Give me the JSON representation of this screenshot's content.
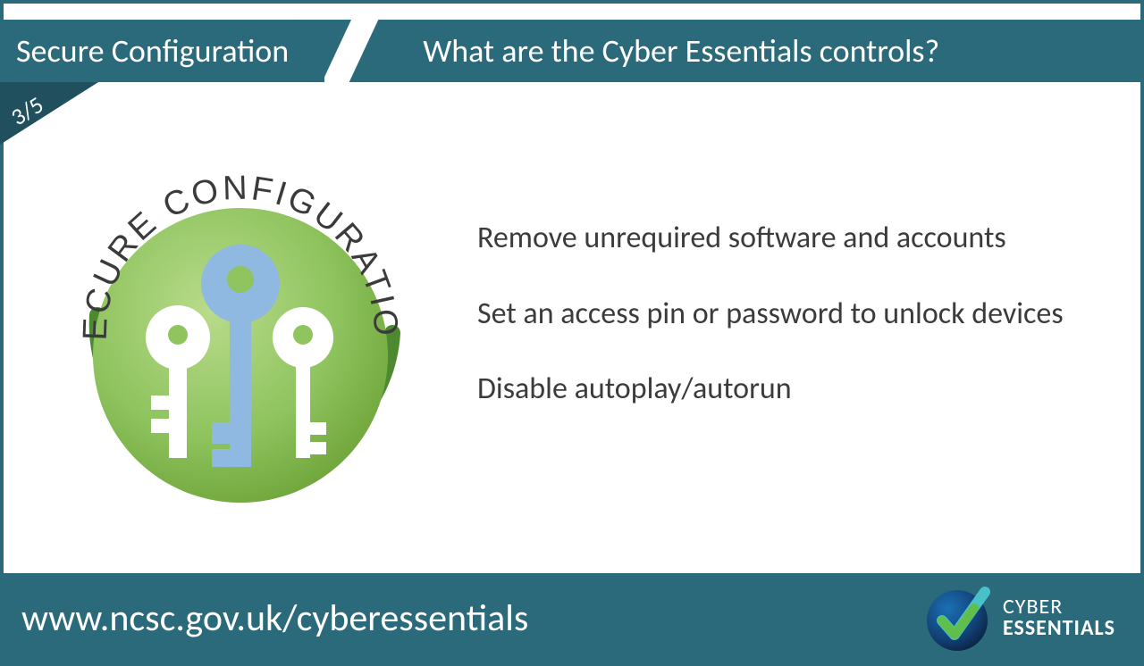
{
  "header": {
    "left": "Secure Configuration",
    "right": "What are the Cyber Essentials controls?"
  },
  "page_indicator": "3/5",
  "badge": {
    "curved_text": "SECURE CONFIGURATION"
  },
  "bullets": [
    "Remove unrequired software and accounts",
    "Set an access pin or password to unlock devices",
    "Disable autoplay/autorun"
  ],
  "footer": {
    "url": "www.ncsc.gov.uk/cyberessentials",
    "logo_line1": "CYBER",
    "logo_line2": "ESSENTIALS"
  },
  "colors": {
    "teal": "#2a6a7b",
    "teal_dark": "#20505e",
    "green": "#6fa53a",
    "green_light": "#9fcf67",
    "green_ring": "#4d8a2f",
    "key_blue": "#8fb9e0",
    "text_gray": "#3b3b3b"
  }
}
